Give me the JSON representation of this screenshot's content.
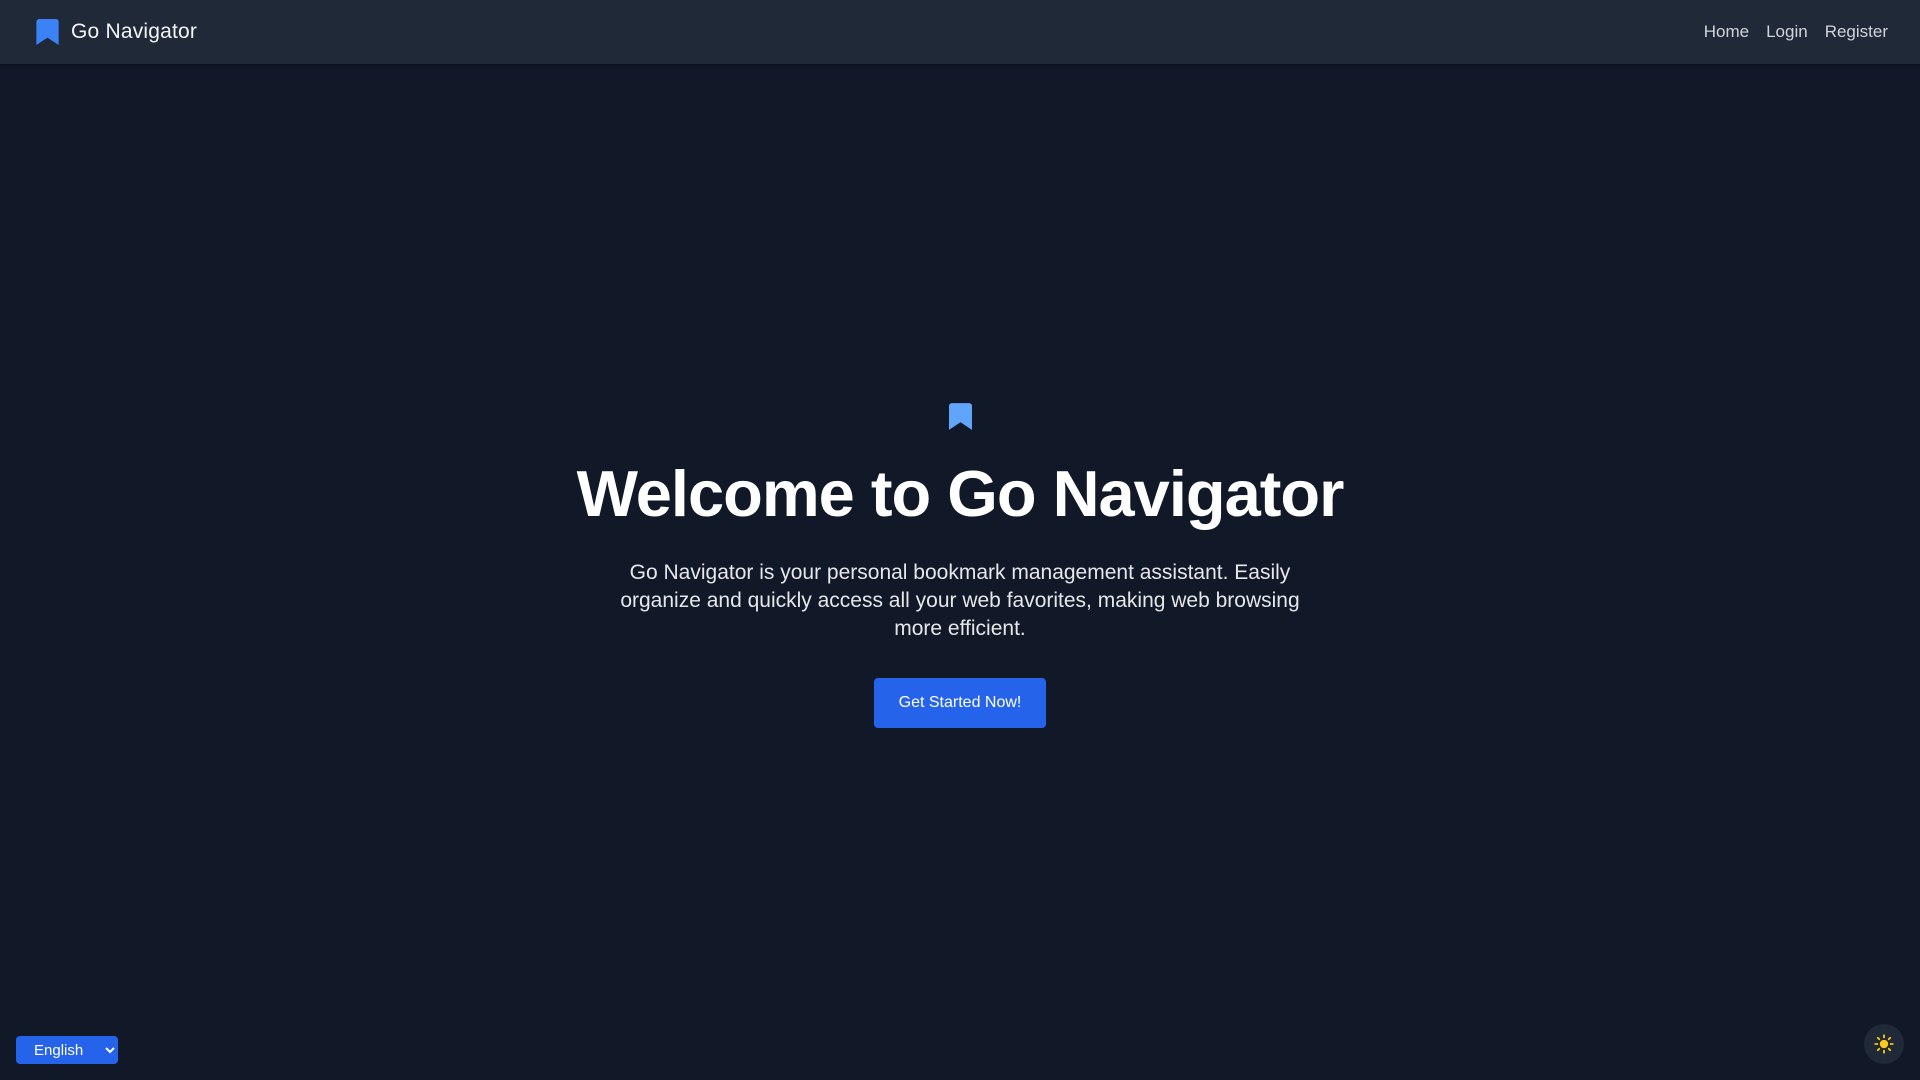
{
  "navbar": {
    "brand_icon": "bookmark-icon",
    "brand_name": "Go Navigator",
    "links": [
      {
        "label": "Home"
      },
      {
        "label": "Login"
      },
      {
        "label": "Register"
      }
    ]
  },
  "hero": {
    "icon": "bookmark-icon",
    "title": "Welcome to Go Navigator",
    "description": "Go Navigator is your personal bookmark management assistant. Easily organize and quickly access all your web favorites, making web browsing more efficient.",
    "cta_label": "Get Started Now!"
  },
  "language_select": {
    "selected": "English",
    "options": [
      "English"
    ]
  },
  "theme_toggle": {
    "icon": "sun-icon"
  },
  "colors": {
    "page_background": "#111827",
    "navbar_background": "#1f2937",
    "brand_icon": "#3b82f6",
    "hero_icon": "#60a5fa",
    "primary_button": "#2563eb",
    "sun_icon": "#facc15"
  }
}
